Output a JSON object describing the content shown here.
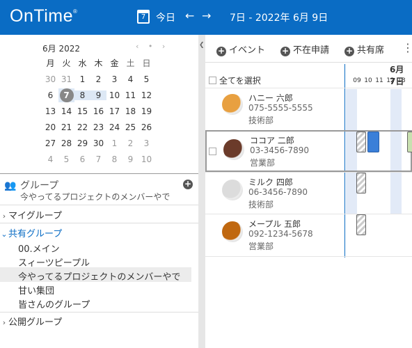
{
  "header": {
    "logo": "OnTime",
    "logo_mark": "®",
    "calendar_day": "7",
    "today_label": "今日",
    "prev_arrow": "←",
    "next_arrow": "→",
    "range": "7日 - 2022年 6月 9日"
  },
  "mini_calendar": {
    "title": "6月 2022",
    "nav": "‹ • ›",
    "dow": [
      "月",
      "火",
      "水",
      "木",
      "金",
      "土",
      "日"
    ],
    "weeks": [
      [
        "30",
        "31",
        "1",
        "2",
        "3",
        "4",
        "5"
      ],
      [
        "6",
        "7",
        "8",
        "9",
        "10",
        "11",
        "12"
      ],
      [
        "13",
        "14",
        "15",
        "16",
        "17",
        "18",
        "19"
      ],
      [
        "20",
        "21",
        "22",
        "23",
        "24",
        "25",
        "26"
      ],
      [
        "27",
        "28",
        "29",
        "30",
        "1",
        "2",
        "3"
      ],
      [
        "4",
        "5",
        "6",
        "7",
        "8",
        "9",
        "10"
      ]
    ],
    "today": "7"
  },
  "groups": {
    "title": "グループ",
    "add": "+",
    "current": "今やってるプロジェクトのメンバーやで",
    "my_group": "マイグループ",
    "shared_group": "共有グループ",
    "shared_items": [
      "00.メイン",
      "スィーツピープル",
      "今やってるプロジェクトのメンバーやで",
      "甘い集団",
      "皆さんのグループ"
    ],
    "public_group": "公開グループ"
  },
  "toolbar": {
    "event": "イベント",
    "absence": "不在申請",
    "shared_seat": "共有席",
    "more": "⋮"
  },
  "schedule": {
    "select_all": "全てを選択",
    "date_head": "6月 7日",
    "hours": [
      "09",
      "10",
      "11",
      "12",
      "13"
    ],
    "people": [
      {
        "name": "ハニー 六郎",
        "phone": "075-5555-5555",
        "dept": "技術部",
        "color": "#e8a040"
      },
      {
        "name": "ココア 二郎",
        "phone": "03-3456-7890",
        "dept": "営業部",
        "color": "#6b3b2a"
      },
      {
        "name": "ミルク 四郎",
        "phone": "06-3456-7890",
        "dept": "技術部",
        "color": "#dcdcdc"
      },
      {
        "name": "メープル 五郎",
        "phone": "092-1234-5678",
        "dept": "営業部",
        "color": "#c06810"
      }
    ]
  }
}
